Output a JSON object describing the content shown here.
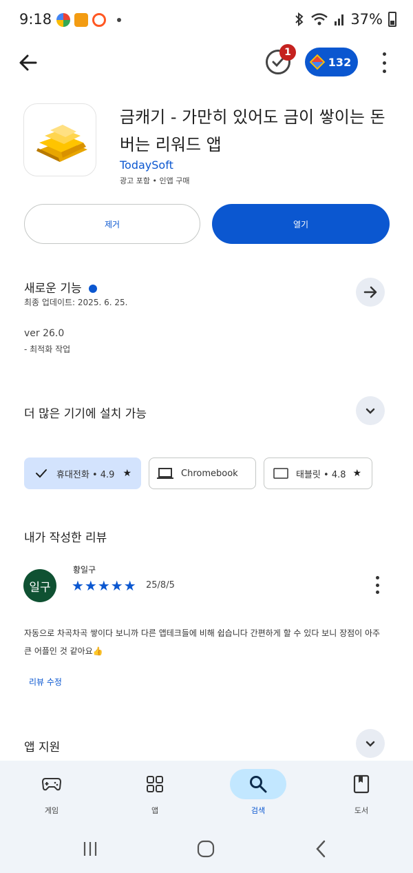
{
  "status_bar": {
    "time": "9:18",
    "battery": "37%"
  },
  "top_bar": {
    "task_badge_count": "1",
    "points": "132"
  },
  "app": {
    "title": "금캐기 - 가만히 있어도 금이 쌓이는 돈버는 리워드 앱",
    "developer": "TodaySoft",
    "meta": "광고 포함 • 인앱 구매",
    "uninstall_label": "제거",
    "open_label": "열기"
  },
  "whats_new": {
    "title": "새로운 기능",
    "updated": "최종 업데이트: 2025. 6. 25.",
    "version": "ver 26.0",
    "note": "- 최적화 작업"
  },
  "devices": {
    "title": "더 많은 기기에 설치 가능",
    "phone_label": "휴대전화 • 4.9",
    "chromebook_label": "Chromebook",
    "tablet_label": "태블릿 • 4.8"
  },
  "my_review": {
    "title": "내가 작성한 리뷰",
    "avatar_text": "일구",
    "reviewer": "황일구",
    "rating": 5,
    "stars": "★★★★★",
    "date": "25/8/5",
    "text": "자동으로 차곡차곡 쌓이다 보니까 다른 앱테크들에 비해 쉽습니다 간편하게 할 수 있다 보니 장점이 아주 큰 어플인 것 같아요👍",
    "edit_label": "리뷰 수정"
  },
  "app_support": {
    "title": "앱 지원"
  },
  "bottom_nav": [
    {
      "label": "게임",
      "icon": "gamepad-icon"
    },
    {
      "label": "앱",
      "icon": "apps-grid-icon"
    },
    {
      "label": "검색",
      "icon": "search-icon",
      "active": true
    },
    {
      "label": "도서",
      "icon": "book-icon"
    }
  ],
  "colors": {
    "accent": "#0b57d0",
    "active_chip": "#d3e3fd",
    "avatar": "#0f5132",
    "badge": "#c5221f"
  }
}
